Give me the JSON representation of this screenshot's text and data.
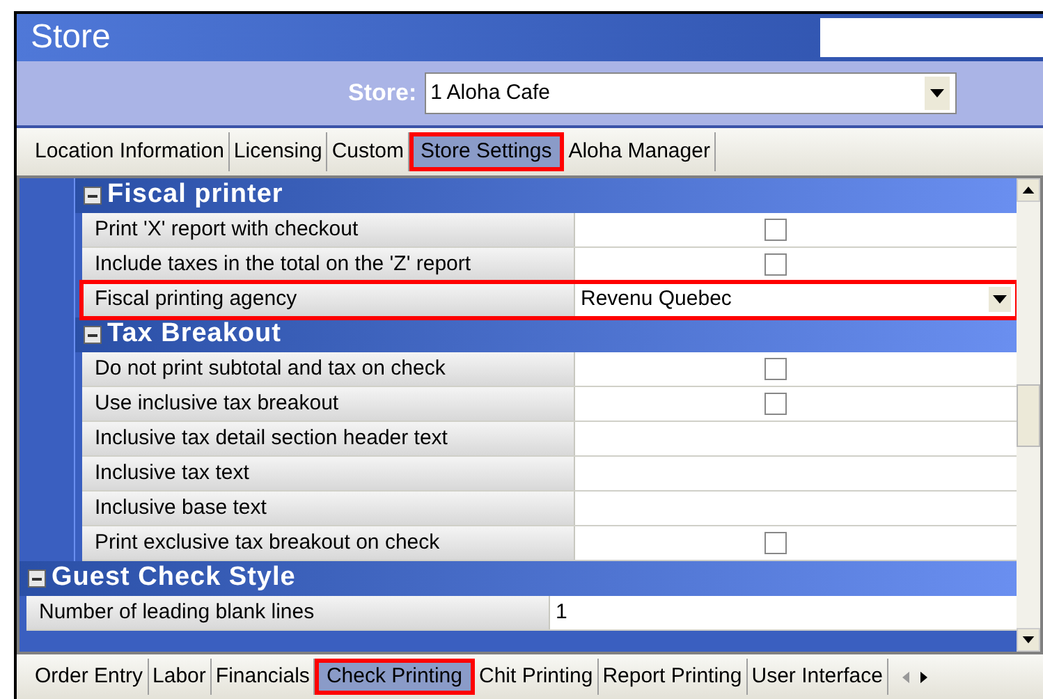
{
  "window": {
    "title": "Store"
  },
  "store_selector": {
    "label": "Store:",
    "value": "1 Aloha Cafe"
  },
  "top_tabs": [
    {
      "label": "Location Information",
      "selected": false,
      "highlighted": false
    },
    {
      "label": "Licensing",
      "selected": false,
      "highlighted": false
    },
    {
      "label": "Custom",
      "selected": false,
      "highlighted": false
    },
    {
      "label": "Store Settings",
      "selected": true,
      "highlighted": true
    },
    {
      "label": "Aloha Manager",
      "selected": false,
      "highlighted": false
    }
  ],
  "grid": {
    "groups": [
      {
        "children": [
          {
            "title": "Fiscal printer",
            "expanded": true,
            "rows": [
              {
                "label": "Print 'X' report with checkout",
                "kind": "checkbox",
                "checked": false,
                "highlighted": false
              },
              {
                "label": "Include taxes in the total on the 'Z' report",
                "kind": "checkbox",
                "checked": false,
                "highlighted": false
              },
              {
                "label": "Fiscal printing agency",
                "kind": "dropdown",
                "value": "Revenu Quebec",
                "highlighted": true
              }
            ]
          },
          {
            "title": "Tax Breakout",
            "expanded": true,
            "rows": [
              {
                "label": "Do not print subtotal and tax on check",
                "kind": "checkbox",
                "checked": false,
                "highlighted": false
              },
              {
                "label": "Use inclusive tax breakout",
                "kind": "checkbox",
                "checked": false,
                "highlighted": false
              },
              {
                "label": "Inclusive tax detail section header text",
                "kind": "text",
                "highlighted": false
              },
              {
                "label": "Inclusive tax text",
                "kind": "text",
                "highlighted": false
              },
              {
                "label": "Inclusive base text",
                "kind": "text",
                "highlighted": false
              },
              {
                "label": "Print exclusive tax breakout on check",
                "kind": "checkbox",
                "checked": false,
                "highlighted": false
              }
            ]
          }
        ]
      },
      {
        "title": "Guest Check Style",
        "expanded": true,
        "rows": [
          {
            "label": "Number of leading blank lines",
            "kind": "text",
            "value": "1",
            "highlighted": false
          }
        ]
      }
    ]
  },
  "bottom_tabs": [
    {
      "label": "Order Entry",
      "selected": false,
      "highlighted": false
    },
    {
      "label": "Labor",
      "selected": false,
      "highlighted": false
    },
    {
      "label": "Financials",
      "selected": false,
      "highlighted": false
    },
    {
      "label": "Check Printing",
      "selected": true,
      "highlighted": true
    },
    {
      "label": "Chit Printing",
      "selected": false,
      "highlighted": false
    },
    {
      "label": "Report Printing",
      "selected": false,
      "highlighted": false
    },
    {
      "label": "User Interface",
      "selected": false,
      "highlighted": false
    }
  ]
}
